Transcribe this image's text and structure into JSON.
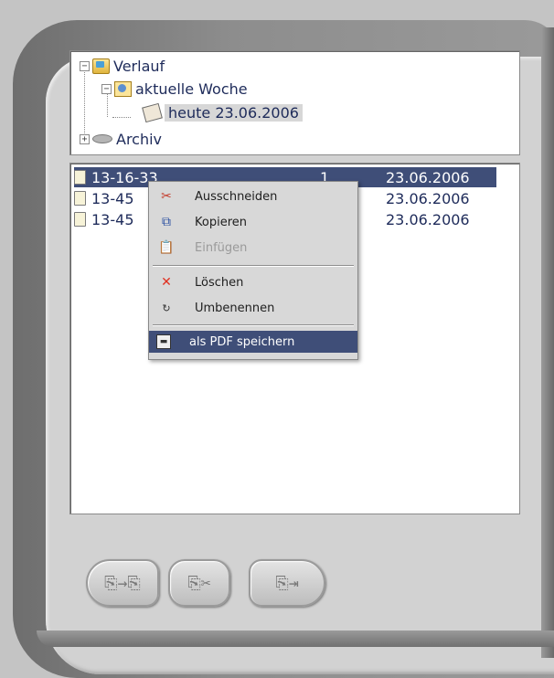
{
  "tree": {
    "nodes": [
      {
        "expander": "−",
        "label": "Verlauf",
        "icon": "history-folder-icon"
      },
      {
        "expander": "−",
        "label": "aktuelle Woche",
        "icon": "week-icon"
      },
      {
        "label": "heute  23.06.2006",
        "icon": "day-icon"
      },
      {
        "expander": "+",
        "label": "Archiv",
        "icon": "archive-disk-icon"
      }
    ]
  },
  "list": {
    "rows": [
      {
        "name": "13-16-33",
        "count": "1",
        "date": "23.06.2006",
        "selected": true
      },
      {
        "name": "13-45",
        "count": "",
        "date": "23.06.2006",
        "selected": false
      },
      {
        "name": "13-45",
        "count": "",
        "date": "23.06.2006",
        "selected": false
      }
    ]
  },
  "context_menu": {
    "items": [
      {
        "label": "Ausschneiden",
        "icon": "scissors-icon",
        "enabled": true
      },
      {
        "label": "Kopieren",
        "icon": "copy-icon",
        "enabled": true
      },
      {
        "label": "Einfügen",
        "icon": "paste-icon",
        "enabled": false
      },
      {
        "label": "Löschen",
        "icon": "delete-icon",
        "enabled": true
      },
      {
        "label": "Umbenennen",
        "icon": "rename-icon",
        "enabled": true
      },
      {
        "label": "als PDF speichern",
        "icon": "save-disk-icon",
        "enabled": true,
        "highlighted": true
      }
    ]
  },
  "toolbar": {
    "buttons": [
      {
        "glyph": "⎘→⎘",
        "icon": "copy-to-icon"
      },
      {
        "glyph": "⎘✂",
        "icon": "cut-doc-icon"
      },
      {
        "glyph": "⎘⇥",
        "icon": "export-doc-icon"
      }
    ]
  },
  "colors": {
    "selection": "#3f4e78",
    "text": "#1e2b5a",
    "frame": "#8d8d8d"
  }
}
